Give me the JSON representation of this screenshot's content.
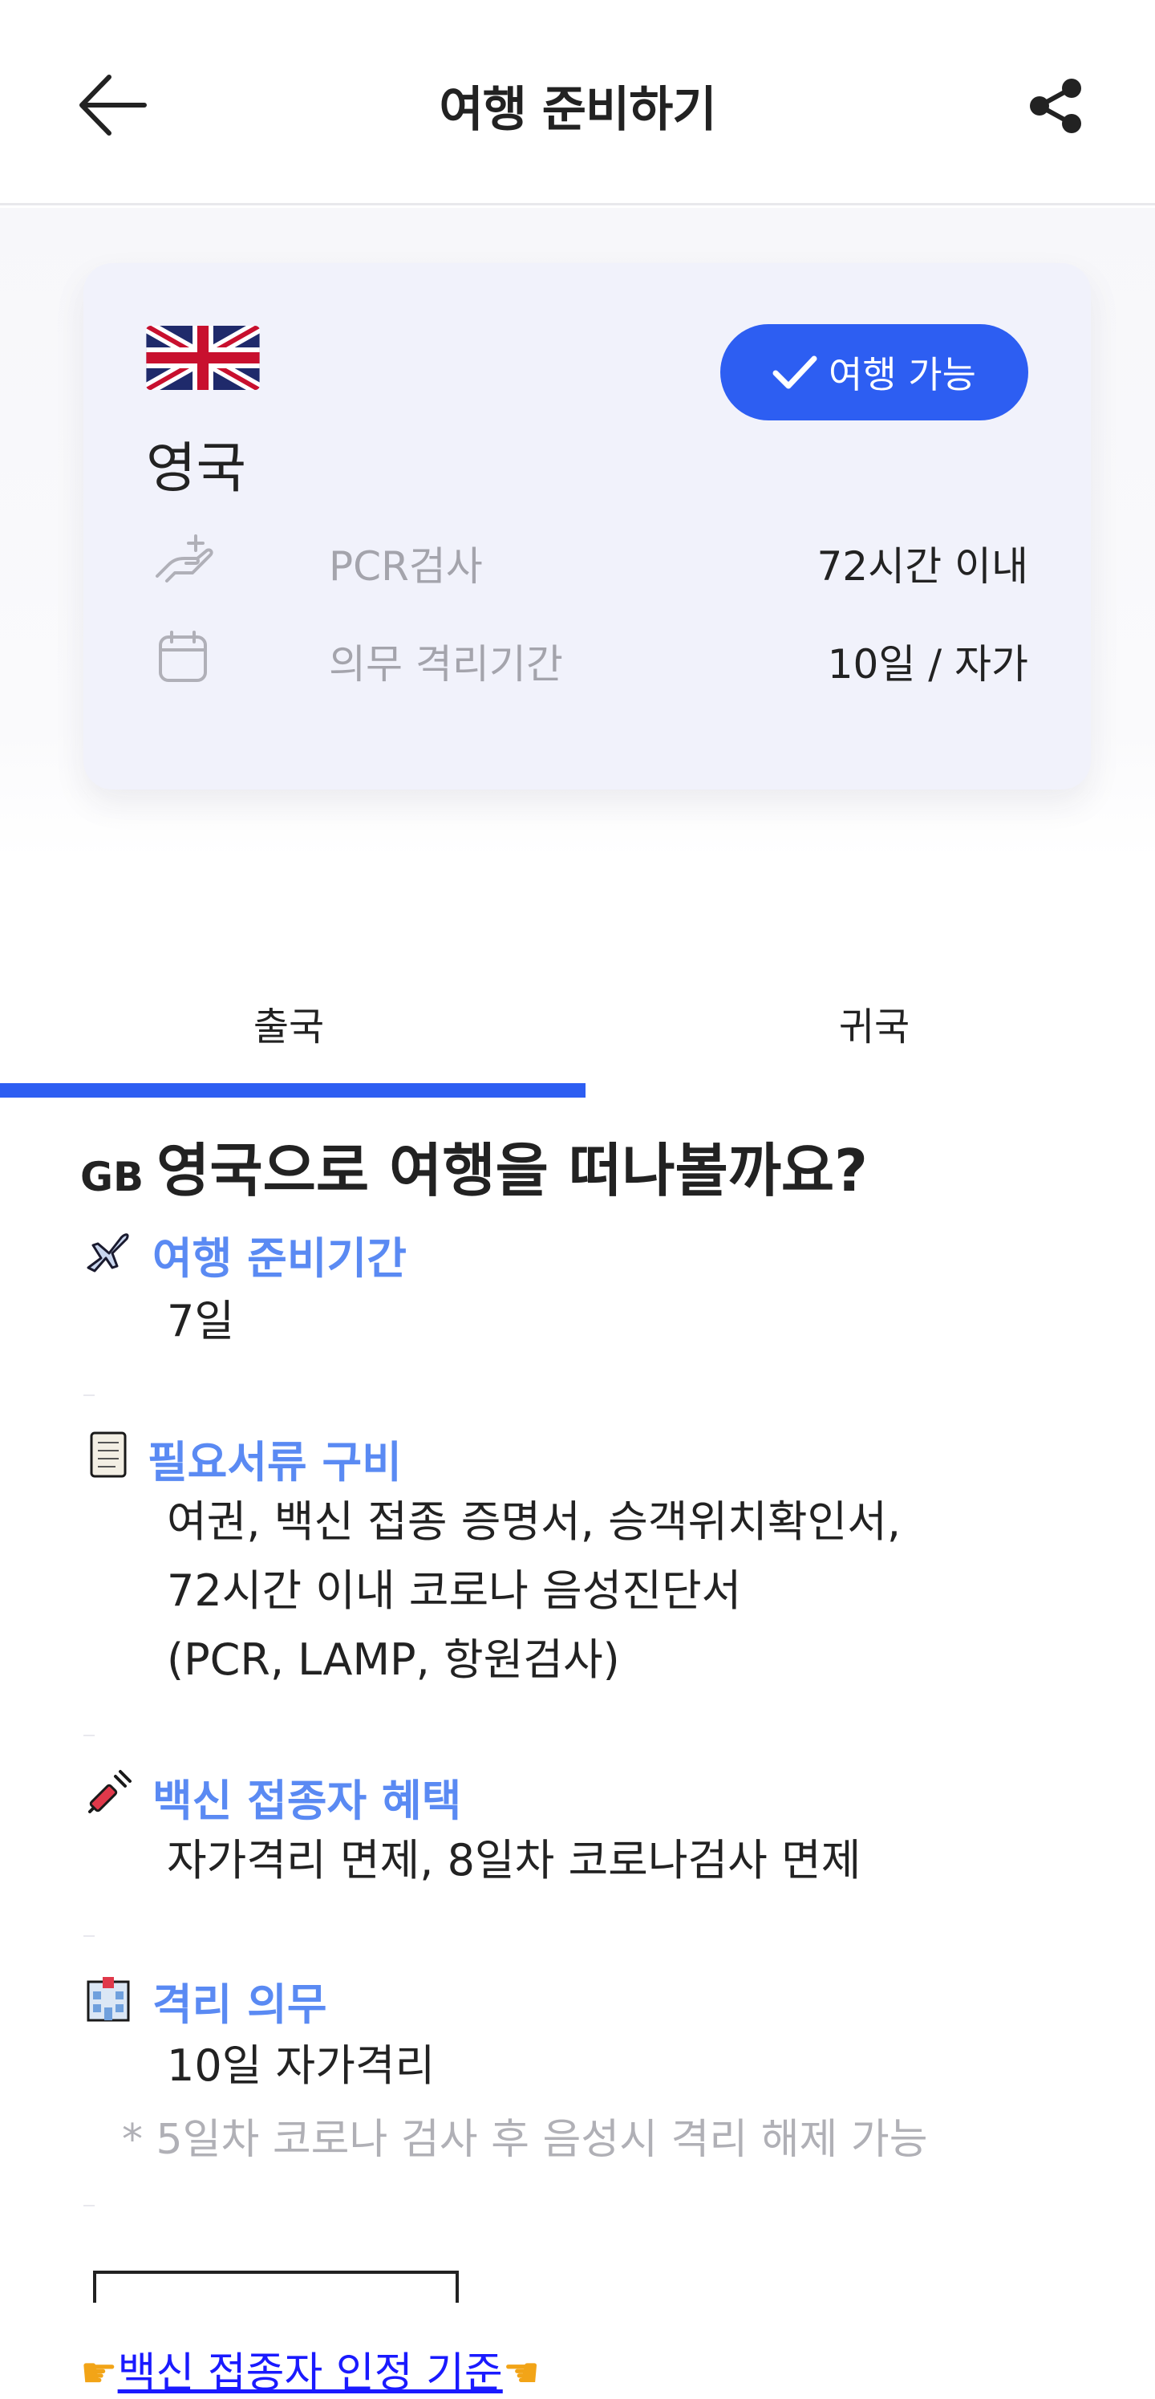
{
  "header": {
    "title": "여행 준비하기"
  },
  "card": {
    "country": "영국",
    "status": "여행 가능",
    "rows": [
      {
        "label": "PCR검사",
        "value": "72시간 이내",
        "icon": "hand-test-icon"
      },
      {
        "label": "의무 격리기간",
        "value": "10일 / 자가",
        "icon": "calendar-icon"
      }
    ],
    "colors": {
      "accent": "#2d5ef2",
      "card_bg": "#f1f2fb"
    }
  },
  "tabs": [
    {
      "label": "출국",
      "active": true
    },
    {
      "label": "귀국",
      "active": false
    }
  ],
  "content": {
    "headline_code": "GB",
    "headline": "영국으로 여행을 떠나볼까요?",
    "sections": [
      {
        "title": "여행 준비기간",
        "icon": "airplane-icon",
        "lines": [
          "7일"
        ]
      },
      {
        "title": "필요서류 구비",
        "icon": "scroll-icon",
        "lines": [
          "여권, 백신 접종 증명서, 승객위치확인서,",
          "72시간 이내 코로나 음성진단서",
          "(PCR, LAMP, 항원검사)"
        ]
      },
      {
        "title": "백신 접종자 혜택",
        "icon": "syringe-icon",
        "lines": [
          "자가격리 면제, 8일차 코로나검사 면제"
        ]
      },
      {
        "title": "격리 의무",
        "icon": "hospital-icon",
        "lines": [
          "10일 자가격리"
        ],
        "note": "* 5일차 코로나 검사 후 음성시 격리 해제 가능"
      }
    ],
    "link_text": "백신 접종자 인정 기준"
  }
}
